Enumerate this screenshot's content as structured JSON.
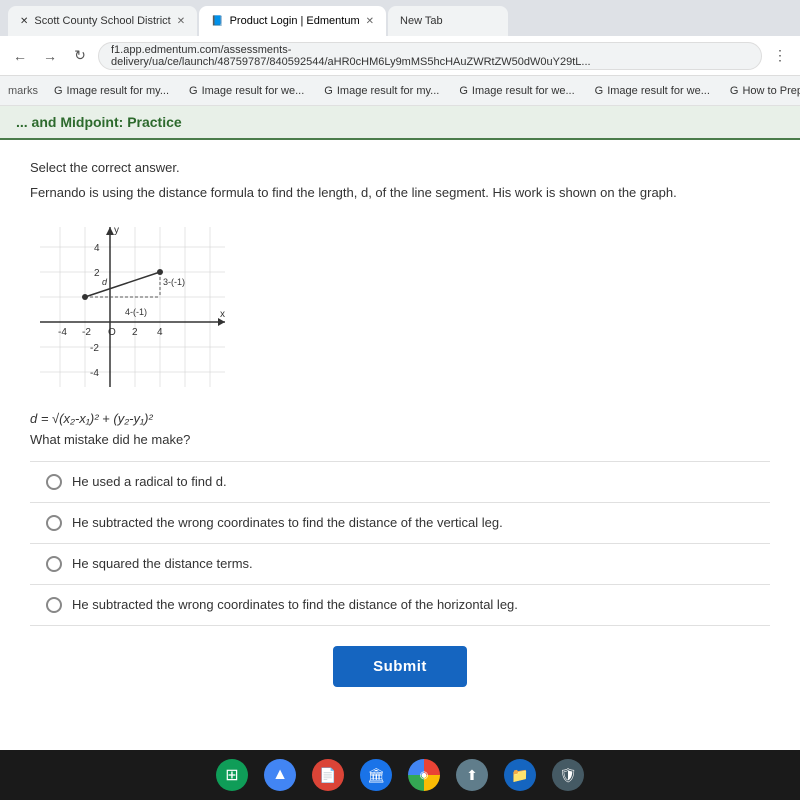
{
  "browser": {
    "tabs": [
      {
        "id": "tab1",
        "label": "Scott County School District",
        "active": false,
        "favicon": "🏫"
      },
      {
        "id": "tab2",
        "label": "Product Login | Edmentum",
        "active": true,
        "favicon": "📘"
      },
      {
        "id": "tab3",
        "label": "New Tab",
        "active": false,
        "favicon": "⊕"
      }
    ],
    "address": "f1.app.edmentum.com/assessments-delivery/ua/ce/launch/48759787/840592544/aHR0cHM6Ly9mMS5hcHAuZWRtZW50dW0uY29tL...",
    "bookmarks": [
      {
        "label": "Image result for my..."
      },
      {
        "label": "Image result for we..."
      },
      {
        "label": "Image result for my..."
      },
      {
        "label": "Image result for we..."
      },
      {
        "label": "Image result for we..."
      },
      {
        "label": "How to Prepare a P..."
      }
    ]
  },
  "page": {
    "header": "... and Midpoint: Practice",
    "instruction": "Select the correct answer.",
    "question_text": "Fernando is using the distance formula to find the length, d, of the line segment. His work is shown on the graph.",
    "formula": "d = √(x₂-x₁)² + (y₂-y₁)²",
    "formula_display": "d = √(x₂-x₁)² + (y₂-y₁)²",
    "mistake_question": "What mistake did he make?",
    "graph": {
      "annotation1": "3-(-1)",
      "annotation2": "4-(-1)"
    },
    "answers": [
      {
        "id": "a",
        "text": "He used a radical to find d."
      },
      {
        "id": "b",
        "text": "He subtracted the wrong coordinates to find the distance of the vertical leg."
      },
      {
        "id": "c",
        "text": "He squared the distance terms."
      },
      {
        "id": "d",
        "text": "He subtracted the wrong coordinates to find the distance of the horizontal leg."
      }
    ],
    "submit_label": "Submit"
  },
  "taskbar": {
    "icons": [
      {
        "name": "sheets-icon",
        "color": "#0f9d58",
        "symbol": "⊞"
      },
      {
        "name": "drive-icon",
        "color": "#4285f4",
        "symbol": "▲"
      },
      {
        "name": "docs-icon",
        "color": "#db4437",
        "symbol": "📄"
      },
      {
        "name": "classroom-icon",
        "color": "#1a73e8",
        "symbol": "🏛"
      },
      {
        "name": "chrome-icon",
        "color": "#fbbc04",
        "symbol": "◉"
      },
      {
        "name": "files-icon",
        "color": "#5f6368",
        "symbol": "🗂"
      },
      {
        "name": "folder-icon",
        "color": "#1565c0",
        "symbol": "📁"
      },
      {
        "name": "settings-icon",
        "color": "#607d8b",
        "symbol": "⚙"
      }
    ]
  }
}
